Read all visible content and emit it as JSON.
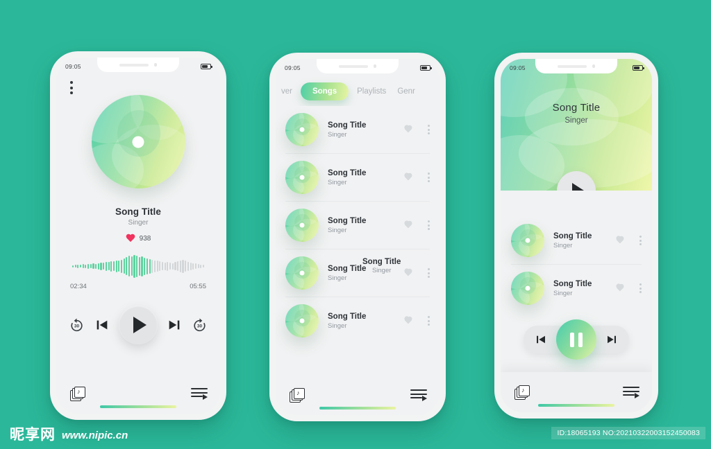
{
  "background_color": "#2bb89a",
  "accent": {
    "gradient_start": "#4ecfa8",
    "gradient_mid": "#a9e290",
    "gradient_end": "#e9f5a4",
    "heart_color": "#f0335f",
    "wave_active": "#5fd2a0",
    "wave_inactive": "#d3d6d8"
  },
  "status_bar": {
    "time": "09:05",
    "battery_level": "70"
  },
  "screen1": {
    "menu_icon": "kebab-menu-icon",
    "album_art": "album-disc",
    "title": "Song Title",
    "artist": "Singer",
    "like_count": "938",
    "time_elapsed": "02:34",
    "time_total": "05:55",
    "progress_percent": 58,
    "controls": {
      "rewind_label": "30",
      "previous": "skip-previous",
      "play": "play",
      "next": "skip-next",
      "forward_label": "30"
    },
    "bottom": {
      "library": "library-icon",
      "queue": "queue-icon"
    }
  },
  "screen2": {
    "tabs": [
      {
        "label": "ver",
        "active": false
      },
      {
        "label": "Songs",
        "active": true
      },
      {
        "label": "Playlists",
        "active": false
      },
      {
        "label": "Genr",
        "active": false
      }
    ],
    "songs": [
      {
        "title": "Song Title",
        "artist": "Singer"
      },
      {
        "title": "Song Title",
        "artist": "Singer"
      },
      {
        "title": "Song Title",
        "artist": "Singer"
      },
      {
        "title": "Song Title",
        "artist": "Singer"
      },
      {
        "title": "Song Title",
        "artist": "Singer"
      }
    ],
    "overlay_label": {
      "title": "Song Title",
      "artist": "Singer"
    },
    "bottom": {
      "library": "library-icon",
      "queue": "queue-icon"
    }
  },
  "screen3": {
    "hero": {
      "title": "Song Title",
      "artist": "Singer",
      "play": "play"
    },
    "songs": [
      {
        "title": "Song Title",
        "artist": "Singer"
      },
      {
        "title": "Song Title",
        "artist": "Singer"
      }
    ],
    "player": {
      "previous": "skip-previous",
      "pause": "pause",
      "next": "skip-next"
    },
    "bottom": {
      "library": "library-icon",
      "queue": "queue-icon"
    }
  },
  "watermark": {
    "site_cn": "昵享网",
    "url": "www.nipic.cn",
    "id_text": "ID:18065193 NO:20210322003152450083"
  }
}
